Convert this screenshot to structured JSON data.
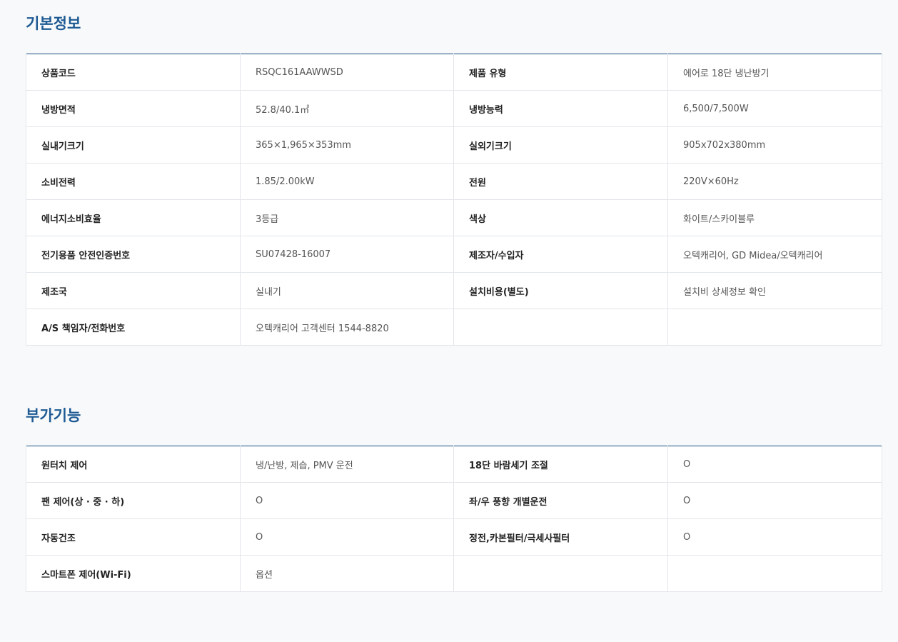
{
  "basic": {
    "title": "기본정보",
    "rows": [
      [
        {
          "label": "상품코드",
          "value": "RSQC161AAWWSD"
        },
        {
          "label": "제품 유형",
          "value": "에어로 18단 냉난방기"
        }
      ],
      [
        {
          "label": "냉방면적",
          "value": "52.8/40.1㎡"
        },
        {
          "label": "냉방능력",
          "value": "6,500/7,500W"
        }
      ],
      [
        {
          "label": "실내기크기",
          "value": "365×1,965×353mm"
        },
        {
          "label": "실외기크기",
          "value": "905x702x380mm"
        }
      ],
      [
        {
          "label": "소비전력",
          "value": "1.85/2.00kW"
        },
        {
          "label": "전원",
          "value": "220V×60Hz"
        }
      ],
      [
        {
          "label": "에너지소비효율",
          "value": "3등급"
        },
        {
          "label": "색상",
          "value": "화이트/스카이블루"
        }
      ],
      [
        {
          "label": "전기용품 안전인증번호",
          "value": "SU07428-16007"
        },
        {
          "label": "제조자/수입자",
          "value": "오텍캐리어, GD Midea/오텍캐리어"
        }
      ],
      [
        {
          "label": "제조국",
          "value": "실내기"
        },
        {
          "label": "설치비용(별도)",
          "value": "설치비 상세정보 확인"
        }
      ],
      [
        {
          "label": "A/S 책임자/전화번호",
          "value": "오텍캐리어 고객센터 1544-8820"
        },
        {
          "label": "",
          "value": ""
        }
      ]
    ]
  },
  "extra": {
    "title": "부가기능",
    "rows": [
      [
        {
          "label": "원터치 제어",
          "value": "냉/난방, 제습, PMV 운전"
        },
        {
          "label": "18단 바람세기 조절",
          "value": "O"
        }
      ],
      [
        {
          "label": "팬 제어(상 · 중 · 하)",
          "value": "O"
        },
        {
          "label": "좌/우 풍향 개별운전",
          "value": "O"
        }
      ],
      [
        {
          "label": "자동건조",
          "value": "O"
        },
        {
          "label": "정전,카본필터/극세사필터",
          "value": "O"
        }
      ],
      [
        {
          "label": "스마트폰 제어(Wi-Fi)",
          "value": "옵션"
        },
        {
          "label": "",
          "value": ""
        }
      ]
    ]
  }
}
